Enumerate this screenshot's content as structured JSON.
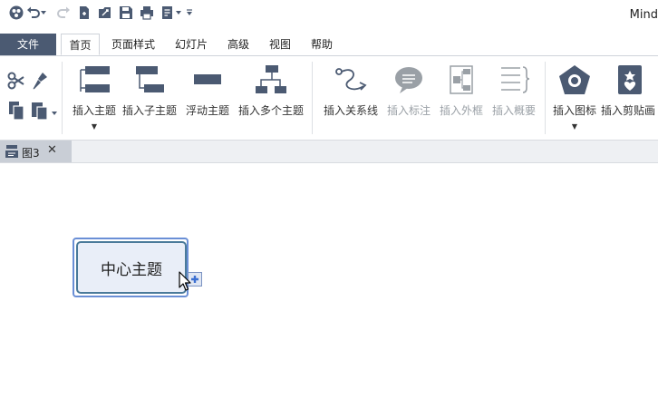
{
  "app": {
    "title": "Mind"
  },
  "quick_access": [
    "app-logo-icon",
    "undo-icon",
    "undo-dropdown-icon",
    "redo-icon",
    "new-icon",
    "open-icon",
    "save-icon",
    "print-icon",
    "export-icon",
    "export-dropdown-icon",
    "customize-icon"
  ],
  "menu": {
    "file": "文件",
    "tabs": [
      "首页",
      "页面样式",
      "幻灯片",
      "高级",
      "视图",
      "帮助"
    ]
  },
  "ribbon": {
    "insert_topic": "插入主题",
    "insert_subtopic": "插入子主题",
    "floating_topic": "浮动主题",
    "insert_multiple": "插入多个主题",
    "insert_relationship": "插入关系线",
    "insert_callout": "插入标注",
    "insert_boundary": "插入外框",
    "insert_summary": "插入概要",
    "insert_icon": "插入图标",
    "insert_clipart": "插入剪贴画"
  },
  "doc_tab": {
    "label": "图3",
    "close": "✕"
  },
  "canvas": {
    "central_topic": "中心主题"
  },
  "colors": {
    "file_tab": "#4b5a72",
    "ribbon_icon": "#4b5a72",
    "topic_fill": "#e9eef8",
    "topic_border": "#4a7a9a",
    "selection": "#6a8fd6"
  }
}
